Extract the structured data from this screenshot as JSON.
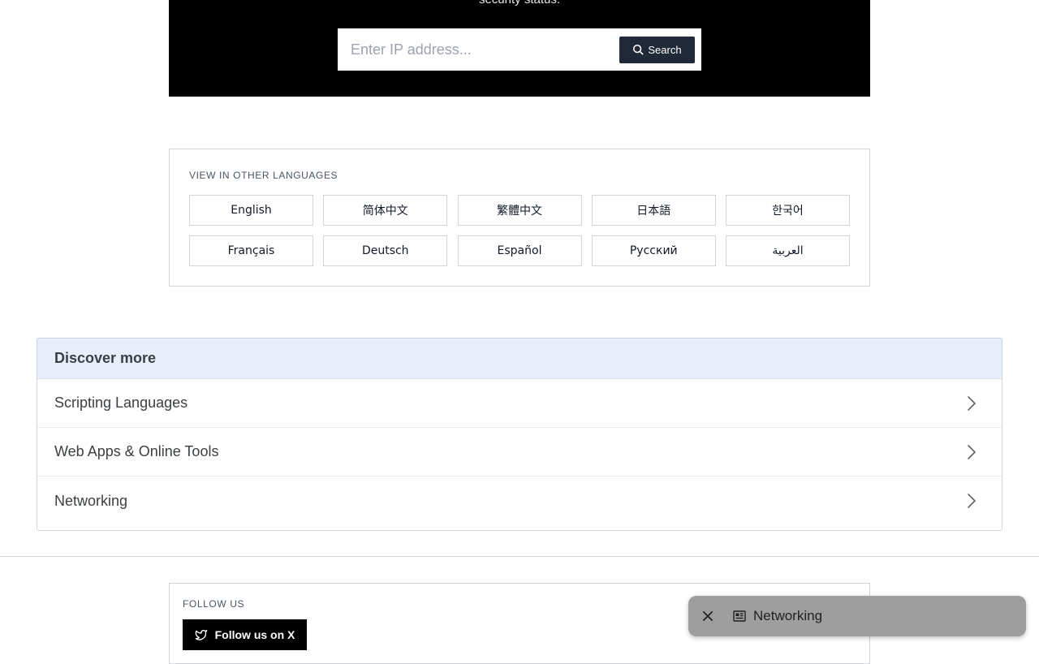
{
  "hero": {
    "tagline": "security status."
  },
  "search": {
    "placeholder": "Enter IP address...",
    "button_label": "Search"
  },
  "languages": {
    "heading": "VIEW IN OTHER LANGUAGES",
    "items": [
      {
        "label": "English"
      },
      {
        "label": "简体中文"
      },
      {
        "label": "繁體中文"
      },
      {
        "label": "日本語"
      },
      {
        "label": "한국어"
      },
      {
        "label": "Français"
      },
      {
        "label": "Deutsch"
      },
      {
        "label": "Español"
      },
      {
        "label": "Русский"
      },
      {
        "label": "العربية"
      }
    ]
  },
  "discover": {
    "title": "Discover more",
    "items": [
      {
        "label": "Scripting Languages"
      },
      {
        "label": "Web Apps & Online Tools"
      },
      {
        "label": "Networking"
      }
    ]
  },
  "follow": {
    "heading": "FOLLOW US",
    "button_label": "Follow us on X"
  },
  "chip": {
    "label": "Networking"
  },
  "colors": {
    "hero_bg": "#000000",
    "search_button_bg": "#1f2937",
    "discover_header_bg": "#e8eefb",
    "chip_bg": "#9e9e9e"
  },
  "icons": {
    "search": "search-icon",
    "chevron": "chevron-right-icon",
    "twitter": "twitter-bird-icon",
    "close": "close-icon",
    "news": "newspaper-icon"
  }
}
